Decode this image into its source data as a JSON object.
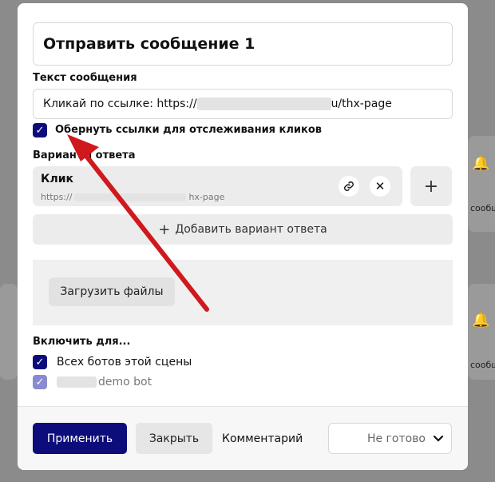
{
  "background": {
    "node_label": "сообщен"
  },
  "modal": {
    "title": "Отправить сообщение 1",
    "message_section_label": "Текст сообщения",
    "message_prefix": "Кликай по ссылке: https://",
    "message_suffix": "u/thx-page",
    "wrap_links_checkbox_label": "Обернуть ссылки для отслеживания кликов",
    "wrap_links_checked": true,
    "answers_section_label": "Варианты ответа",
    "answers": [
      {
        "title": "Клик",
        "url_prefix": "https://",
        "url_suffix": "hx-page"
      }
    ],
    "add_answer_label": "Добавить вариант ответа",
    "add_answer_icon": "plus-icon",
    "upload_button_label": "Загрузить файлы",
    "enable_for_label": "Включить для...",
    "enable_options": [
      {
        "label": "Всех ботов этой сцены",
        "checked": true
      },
      {
        "label": "demo bot",
        "checked": true
      }
    ]
  },
  "footer": {
    "apply_label": "Применить",
    "close_label": "Закрыть",
    "comment_label": "Комментарий",
    "status_value": "Не готово"
  },
  "colors": {
    "primary": "#0c0c7a",
    "arrow": "#d0191d"
  }
}
